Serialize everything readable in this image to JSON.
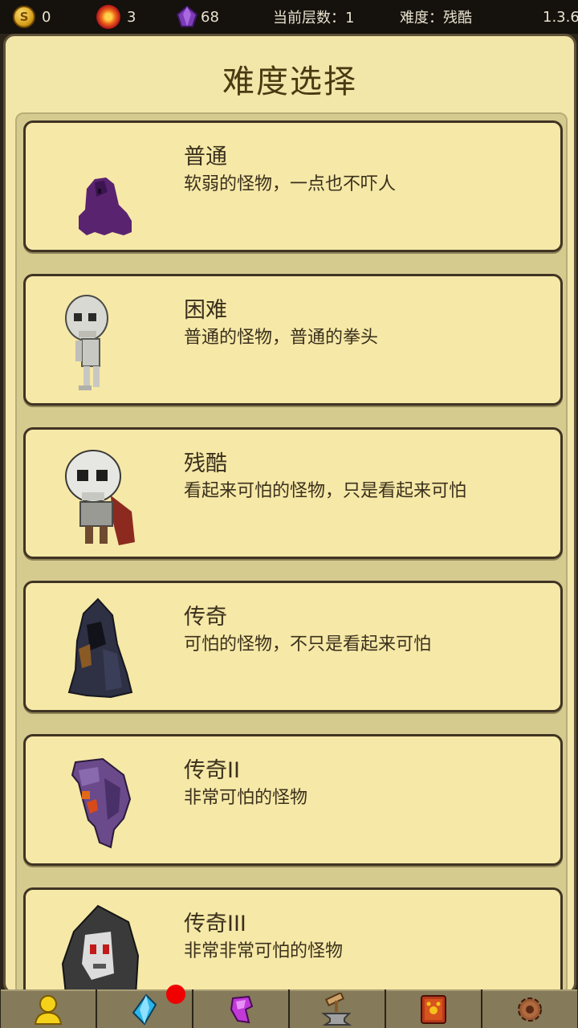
{
  "status_bar": {
    "coins": "0",
    "fire_gems": "3",
    "purple_gems": "68",
    "floor_label": "当前层数：1",
    "difficulty_label": "难度：残酷",
    "version": "1.3.6"
  },
  "panel": {
    "title": "难度选择"
  },
  "difficulties": [
    {
      "name": "普通",
      "desc": "软弱的怪物，一点也不吓人",
      "monster": "purple-slime"
    },
    {
      "name": "困难",
      "desc": "普通的怪物，普通的拳头",
      "monster": "skeleton"
    },
    {
      "name": "残酷",
      "desc": "看起来可怕的怪物，只是看起来可怕",
      "monster": "skeleton-warrior"
    },
    {
      "name": "传奇",
      "desc": "可怕的怪物，不只是看起来可怕",
      "monster": "hooded-wraith"
    },
    {
      "name": "传奇II",
      "desc": "非常可怕的怪物",
      "monster": "purple-ghost"
    },
    {
      "name": "传奇III",
      "desc": "非常非常可怕的怪物",
      "monster": "grim-reaper"
    }
  ],
  "bottom_nav": {
    "tabs": [
      "hero-icon",
      "crystal-icon",
      "gem-icon",
      "anvil-icon",
      "spellbook-icon",
      "gear-icon"
    ],
    "notification_on": "crystal-icon"
  },
  "colors": {
    "panel_bg": "#f3e6a9",
    "card_border": "#3f3423",
    "title_text": "#4a3a12",
    "notification": "#f00000"
  }
}
